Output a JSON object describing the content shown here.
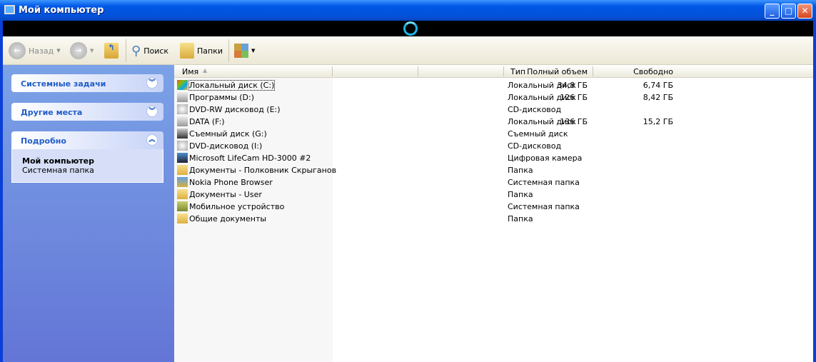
{
  "window": {
    "title": "Мой компьютер",
    "minimize": "_",
    "maximize": "□",
    "close": "✕"
  },
  "toolbar": {
    "back": "Назад",
    "search": "Поиск",
    "folders": "Папки"
  },
  "left": {
    "panels": [
      {
        "title": "Системные задачи"
      },
      {
        "title": "Другие места"
      },
      {
        "title": "Подробно",
        "detail_title": "Мой компьютер",
        "detail_sub": "Системная папка"
      }
    ]
  },
  "columns": [
    "Имя",
    "Полный объем",
    "Свободно",
    "Тип"
  ],
  "rows": [
    {
      "name": "Локальный диск (C:)",
      "size": "34,8 ГБ",
      "free": "6,74 ГБ",
      "type": "Локальный диск",
      "icon": "drive-windows-icon"
    },
    {
      "name": "Программы (D:)",
      "size": "126 ГБ",
      "free": "8,42 ГБ",
      "type": "Локальный диск",
      "icon": "hard-drive-icon"
    },
    {
      "name": "DVD-RW дисковод (E:)",
      "size": "",
      "free": "",
      "type": "CD-дисковод",
      "icon": "dvd-drive-icon"
    },
    {
      "name": "DATA (F:)",
      "size": "136 ГБ",
      "free": "15,2 ГБ",
      "type": "Локальный диск",
      "icon": "hard-drive-icon"
    },
    {
      "name": "Съемный диск (G:)",
      "size": "",
      "free": "",
      "type": "Съемный диск",
      "icon": "removable-drive-icon"
    },
    {
      "name": "DVD-дисковод (I:)",
      "size": "",
      "free": "",
      "type": "CD-дисковод",
      "icon": "dvd-drive-icon"
    },
    {
      "name": "Microsoft LifeCam HD-3000 #2",
      "size": "",
      "free": "",
      "type": "Цифровая камера",
      "icon": "camera-icon"
    },
    {
      "name": "Документы - Полковник Скрыганов",
      "size": "",
      "free": "",
      "type": "Папка",
      "icon": "folder-icon"
    },
    {
      "name": "Nokia Phone Browser",
      "size": "",
      "free": "",
      "type": "Системная папка",
      "icon": "phone-browser-icon"
    },
    {
      "name": "Документы - User",
      "size": "",
      "free": "",
      "type": "Папка",
      "icon": "folder-icon"
    },
    {
      "name": "Мобильное устройство",
      "size": "",
      "free": "",
      "type": "Системная папка",
      "icon": "mobile-device-icon"
    },
    {
      "name": "Общие документы",
      "size": "",
      "free": "",
      "type": "Папка",
      "icon": "folder-icon"
    }
  ]
}
